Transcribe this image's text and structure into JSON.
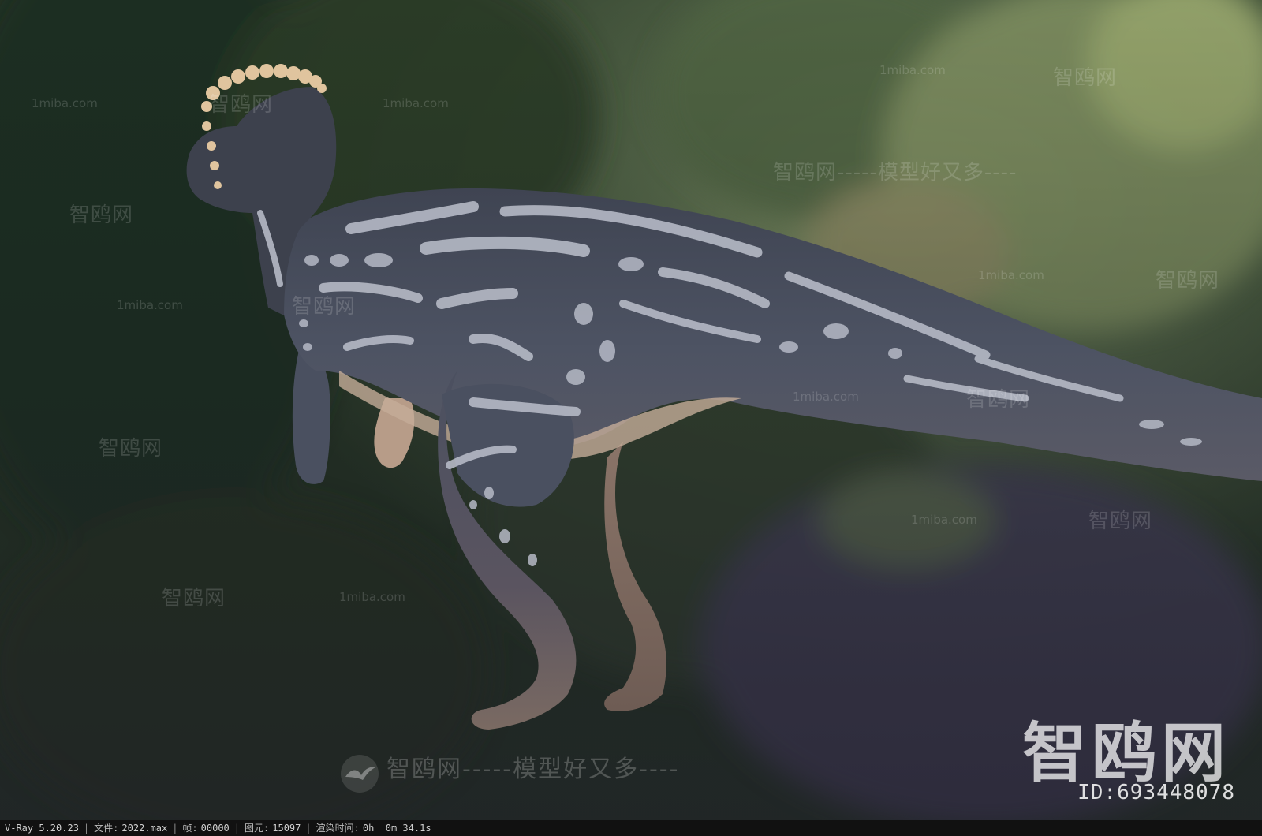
{
  "watermarks": {
    "site_url": "1miba.com",
    "brand": "智鸥网",
    "slogan": "智鸥网-----模型好又多----",
    "slogan_long": "智鸥网-----模型好又多----"
  },
  "brand_overlay": {
    "logo_text": "智鸥网",
    "id_text": "ID:693448078"
  },
  "status_bar": {
    "renderer": "V-Ray 5.20.23",
    "file_label": "文件:",
    "file_value": "2022.max",
    "frame_label": "帧:",
    "frame_value": "00000",
    "primitives_label": "图元:",
    "primitives_value": "15097",
    "render_time_label": "渲染时间:",
    "render_time_value": "0h  0m 34.1s"
  },
  "colors": {
    "body_skin": "#4a4f5e",
    "stripe": "#b8bcc8",
    "belly": "#c9b3a0",
    "crest_knobs": "#e2c7a4",
    "background_forest": "#2f3f2c"
  }
}
